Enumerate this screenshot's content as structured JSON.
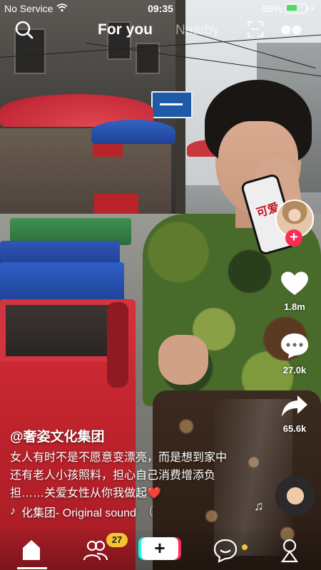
{
  "status_bar": {
    "carrier": "No Service",
    "time": "09:35",
    "battery_percent_text": "59%",
    "battery_level": 0.59
  },
  "top_nav": {
    "tabs": [
      {
        "label": "For you",
        "active": true
      },
      {
        "label": "Nearby",
        "active": false
      }
    ],
    "icons": [
      "search-icon",
      "scan-icon",
      "live-icon"
    ]
  },
  "video": {
    "author": "@奢姿文化集团",
    "caption": "女人有时不是不愿意变漂亮，而是想到家中还有老人小孩照料，担心自己消费增添负担……关爱女性从你我做起❤️",
    "sound": "化集团- Original sound",
    "sound_trail": "(",
    "phone_sticker_text": "可爱"
  },
  "right_rail": {
    "likes": "1.8m",
    "comments": "27.0k",
    "shares": "65.6k",
    "follow_label": "+"
  },
  "tab_bar": {
    "items": [
      "home",
      "friends",
      "create",
      "inbox",
      "profile"
    ],
    "friends_badge": "27",
    "create_label": "+"
  },
  "colors": {
    "accent_pink": "#fe2c55",
    "accent_cyan": "#25f4ee",
    "badge_yellow": "#f6c431",
    "battery_green": "#4cd964"
  }
}
